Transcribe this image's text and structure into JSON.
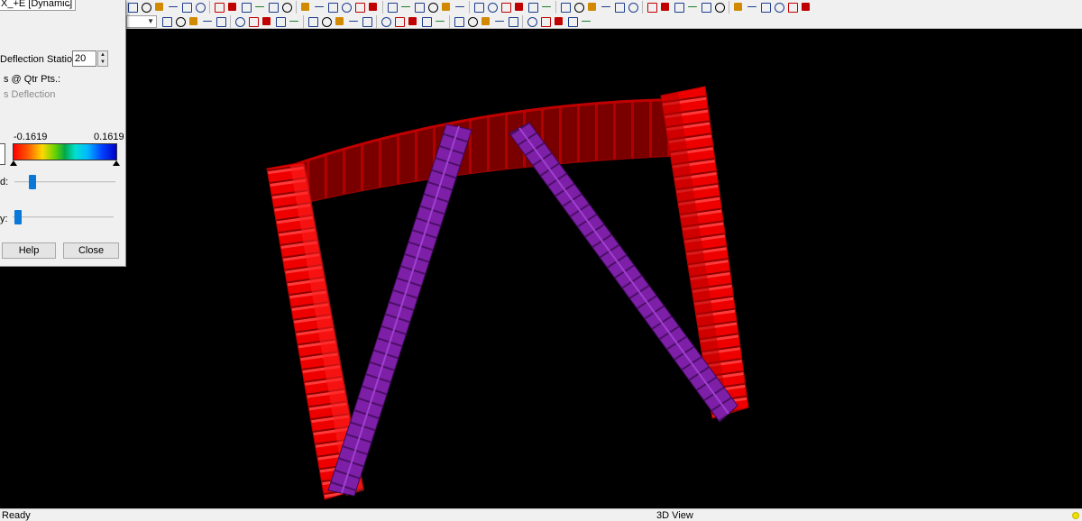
{
  "dialog": {
    "load_case": "X_+E [Dynamic]",
    "deflection_stations_label": "Deflection Stations:",
    "deflection_stations_value": "20",
    "qtr_points_label": "s @ Qtr Pts.:",
    "deflection_label": "s Deflection",
    "scale_min": "-0.1619",
    "scale_max": "0.1619",
    "slider1_label": "d:",
    "slider1_level": 0.15,
    "slider2_label": "y:",
    "slider2_level": 0.02,
    "help_button": "Help",
    "close_button": "Close"
  },
  "viewport": {
    "title": "3D View",
    "background": "#000000",
    "member_color_red": "#ff0000",
    "member_color_dark_red": "#8b0000",
    "brace_color_purple": "#7a1fa0"
  },
  "toolbars": {
    "row1_icons": [
      "render-icon",
      "model-icon",
      "pan-icon",
      "zoom-box-icon",
      "zoom-in-icon",
      "zoom-out-icon",
      "rotate-icon",
      "grid-icon",
      "support-icon",
      "member-icon",
      "plate-icon",
      "load-icon",
      "moment-icon",
      "results-icon",
      "deflection-icon",
      "table-icon",
      "filter-icon",
      "view-icon",
      "refresh-icon",
      "color-icon"
    ],
    "row2_icons": [
      "load-case-icon",
      "select-icon",
      "node-icon",
      "member-tool-icon",
      "copy-icon",
      "paste-icon",
      "undo-icon",
      "redo-icon",
      "graph-icon",
      "link-icon",
      "axis-icon",
      "stress-icon",
      "rf-icon",
      "mesh-icon"
    ]
  },
  "status": {
    "left": "Ready",
    "center": "3D View",
    "indicator_color": "#f0e000"
  }
}
